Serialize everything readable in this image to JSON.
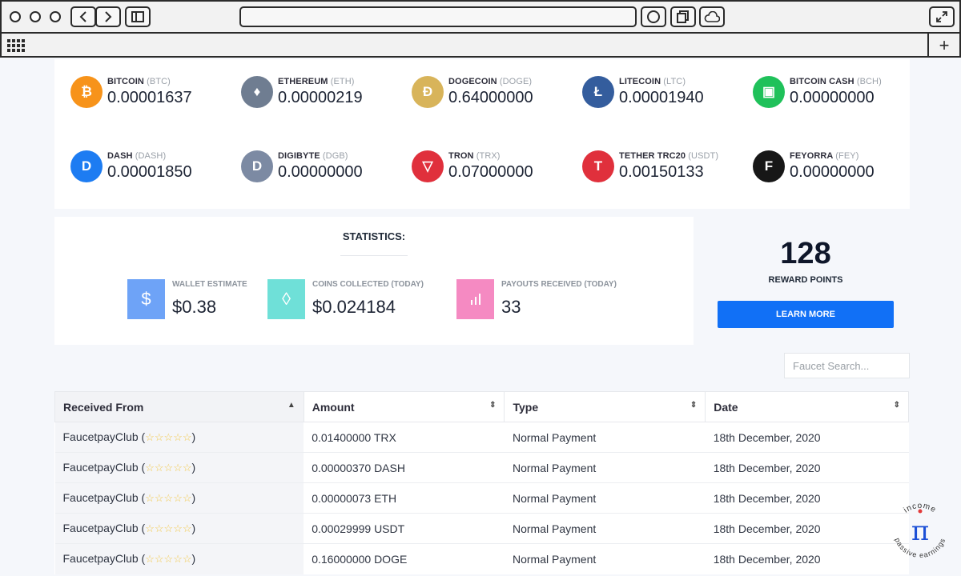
{
  "browser": {
    "back_icon": "chevron-left-icon",
    "forward_icon": "chevron-right-icon",
    "sidebar_icon": "sidebar-icon"
  },
  "coins": [
    {
      "name": "BITCOIN",
      "symbol": "(BTC)",
      "value": "0.00001637",
      "color": "#f7931a",
      "glyph": "₿"
    },
    {
      "name": "ETHEREUM",
      "symbol": "(ETH)",
      "value": "0.00000219",
      "color": "#6f7d91",
      "glyph": "♦"
    },
    {
      "name": "DOGECOIN",
      "symbol": "(DOGE)",
      "value": "0.64000000",
      "color": "#d8b45a",
      "glyph": "Ð"
    },
    {
      "name": "LITECOIN",
      "symbol": "(LTC)",
      "value": "0.00001940",
      "color": "#345d9d",
      "glyph": "Ł"
    },
    {
      "name": "BITCOIN CASH",
      "symbol": "(BCH)",
      "value": "0.00000000",
      "color": "#1fc15a",
      "glyph": "▣"
    },
    {
      "name": "DASH",
      "symbol": "(DASH)",
      "value": "0.00001850",
      "color": "#1d7cf2",
      "glyph": "D"
    },
    {
      "name": "DIGIBYTE",
      "symbol": "(DGB)",
      "value": "0.00000000",
      "color": "#7c8aa3",
      "glyph": "D"
    },
    {
      "name": "TRON",
      "symbol": "(TRX)",
      "value": "0.07000000",
      "color": "#e0303c",
      "glyph": "▽"
    },
    {
      "name": "TETHER TRC20",
      "symbol": "(USDT)",
      "value": "0.00150133",
      "color": "#e0303c",
      "glyph": "T"
    },
    {
      "name": "FEYORRA",
      "symbol": "(FEY)",
      "value": "0.00000000",
      "color": "#171717",
      "glyph": "F"
    }
  ],
  "statistics": {
    "title": "STATISTICS:",
    "items": [
      {
        "label": "WALLET ESTIMATE",
        "value": "$0.38",
        "color": "#6ea3f7",
        "glyph": "$"
      },
      {
        "label": "COINS COLLECTED (TODAY)",
        "value": "$0.024184",
        "color": "#6fe0d8",
        "glyph": "◊"
      },
      {
        "label": "PAYOUTS RECEIVED (TODAY)",
        "value": "33",
        "color": "#f58ac2",
        "glyph": "▮"
      }
    ]
  },
  "reward": {
    "points": "128",
    "label": "REWARD POINTS",
    "button": "LEARN MORE"
  },
  "search": {
    "placeholder": "Faucet Search..."
  },
  "table": {
    "headers": [
      "Received From",
      "Amount",
      "Type",
      "Date"
    ],
    "rows": [
      {
        "from": "FaucetpayClub",
        "stars": "☆☆☆☆☆",
        "amount": "0.01400000 TRX",
        "type": "Normal Payment",
        "date": "18th December, 2020"
      },
      {
        "from": "FaucetpayClub",
        "stars": "☆☆☆☆☆",
        "amount": "0.00000370 DASH",
        "type": "Normal Payment",
        "date": "18th December, 2020"
      },
      {
        "from": "FaucetpayClub",
        "stars": "☆☆☆☆☆",
        "amount": "0.00000073 ETH",
        "type": "Normal Payment",
        "date": "18th December, 2020"
      },
      {
        "from": "FaucetpayClub",
        "stars": "☆☆☆☆☆",
        "amount": "0.00029999 USDT",
        "type": "Normal Payment",
        "date": "18th December, 2020"
      },
      {
        "from": "FaucetpayClub",
        "stars": "☆☆☆☆☆",
        "amount": "0.16000000 DOGE",
        "type": "Normal Payment",
        "date": "18th December, 2020"
      }
    ]
  },
  "watermark": {
    "top_text": "income",
    "bottom_text": "passive earnings",
    "glyph": "π"
  }
}
